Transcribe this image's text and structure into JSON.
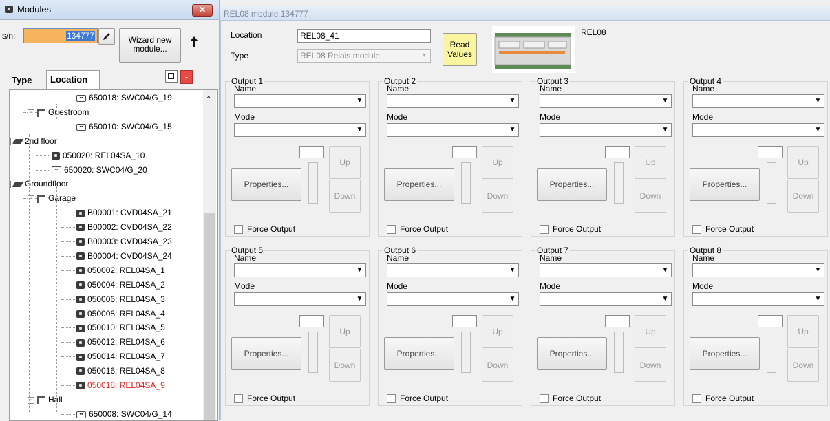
{
  "modules_panel": {
    "title": "Modules",
    "sn_label": "s/n:",
    "sn_value": "134777",
    "wizard_button": "Wizard new module...",
    "tabs": [
      "Type",
      "Location"
    ],
    "tree": [
      {
        "label": "650018: SWC04/G_19",
        "icon": "grid-module-icon",
        "color": "#000000"
      },
      {
        "label": "Guestroom",
        "icon": "room-icon",
        "color": "#000000"
      },
      {
        "label": "650010: SWC04/G_15",
        "icon": "grid-module-icon",
        "color": "#000000"
      },
      {
        "label": "2nd floor",
        "icon": "floor-icon",
        "color": "#000000"
      },
      {
        "label": "050020: REL04SA_10",
        "icon": "module-icon",
        "color": "#000000"
      },
      {
        "label": "650020: SWC04/G_20",
        "icon": "grid-module-icon",
        "color": "#000000"
      },
      {
        "label": "Groundfloor",
        "icon": "floor-icon",
        "color": "#000000"
      },
      {
        "label": "Garage",
        "icon": "room-icon",
        "color": "#000000"
      },
      {
        "label": "B00001: CVD04SA_21",
        "icon": "module-icon",
        "color": "#000000"
      },
      {
        "label": "B00002: CVD04SA_22",
        "icon": "module-icon",
        "color": "#000000"
      },
      {
        "label": "B00003: CVD04SA_23",
        "icon": "module-icon",
        "color": "#000000"
      },
      {
        "label": "B00004: CVD04SA_24",
        "icon": "module-icon",
        "color": "#000000"
      },
      {
        "label": "050002: REL04SA_1",
        "icon": "module-icon",
        "color": "#000000"
      },
      {
        "label": "050004: REL04SA_2",
        "icon": "module-icon",
        "color": "#000000"
      },
      {
        "label": "050006: REL04SA_3",
        "icon": "module-icon",
        "color": "#000000"
      },
      {
        "label": "050008: REL04SA_4",
        "icon": "module-icon",
        "color": "#000000"
      },
      {
        "label": "050010: REL04SA_5",
        "icon": "module-icon",
        "color": "#000000"
      },
      {
        "label": "050012: REL04SA_6",
        "icon": "module-icon",
        "color": "#000000"
      },
      {
        "label": "050014: REL04SA_7",
        "icon": "module-icon",
        "color": "#000000"
      },
      {
        "label": "050016: REL04SA_8",
        "icon": "module-icon",
        "color": "#000000"
      },
      {
        "label": "050018: REL04SA_9",
        "icon": "module-icon",
        "color": "#e02020"
      },
      {
        "label": "Hall",
        "icon": "room-icon",
        "color": "#000000"
      },
      {
        "label": "650008: SWC04/G_14",
        "icon": "grid-module-icon",
        "color": "#000000"
      }
    ]
  },
  "module_panel": {
    "title": "REL08 module 134777",
    "location_label": "Location",
    "location_value": "REL08_41",
    "type_label": "Type",
    "type_value": "REL08 Relais module",
    "read_values_button": "Read Values",
    "image_caption": "REL08",
    "outputs": [
      {
        "title": "Output 1"
      },
      {
        "title": "Output 2"
      },
      {
        "title": "Output 3"
      },
      {
        "title": "Output 4"
      },
      {
        "title": "Output 5"
      },
      {
        "title": "Output 6"
      },
      {
        "title": "Output 7"
      },
      {
        "title": "Output 8"
      }
    ],
    "labels": {
      "name": "Name",
      "mode": "Mode",
      "properties": "Properties...",
      "up": "Up",
      "down": "Down",
      "force_output": "Force Output"
    }
  },
  "colors": {
    "sn_highlight": "#f7b45f",
    "read_values_bg": "#fbf5a0",
    "selected_tree_item": "#e02020"
  }
}
